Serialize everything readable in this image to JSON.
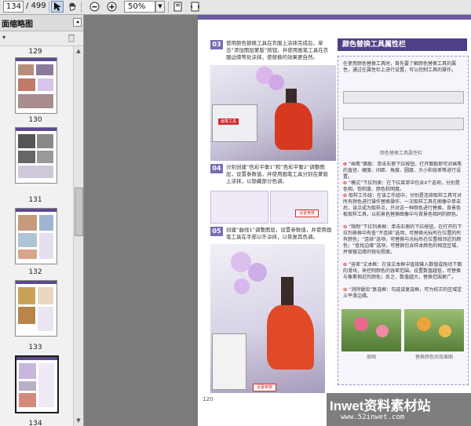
{
  "toolbar": {
    "current_page": "134",
    "total_pages": "/ 499",
    "zoom": "50%",
    "buttons": [
      "select-tool",
      "hand-tool",
      "zoom-out",
      "zoom-in",
      "fit-page",
      "fit-width"
    ]
  },
  "sidebar": {
    "title": "面缩略图",
    "options_glyph": "▾",
    "thumbnails": [
      {
        "label": "129"
      },
      {
        "label": "130"
      },
      {
        "label": "131"
      },
      {
        "label": "132"
      },
      {
        "label": "133"
      },
      {
        "label": "134",
        "selected": true
      }
    ]
  },
  "page": {
    "step3_num": "03",
    "step3_text": "使用颜色替换工具在衣服上涂抹完成后，单击“添加图层蒙版”按钮，并使用画笔工具在衣服边缘等处涂抹，使替换的效果更自然。",
    "step3_tag": "画笔工具",
    "step4_num": "04",
    "step4_text": "分别创建“色彩平衡1”和“色彩平衡2”调整图层，设置参数值，并使用画笔工具分别在蒙版上涂抹，以隐藏部分色调。",
    "step4_tag": "设置参数",
    "step5_num": "05",
    "step5_text": "创建“曲线1”调整图层，设置参数值，并使用画笔工具在手部以外涂抹，以恢复其色调。",
    "step5_tag": "设置参数",
    "side_heading": "颜色替换工具属性栏",
    "side_intro": "在使用颜色替换工具时，首先要了解颜色替换工具的属性，通过在属性栏上进行设置，可以控制工具的操作。",
    "toolbar_caption": "颜色替换工具属性栏",
    "items": [
      {
        "n": "❶",
        "text": "“画笔”面板：单击右侧下拉按钮，打开面板即可对画笔的直径、硬度、间距、角度、圆度、大小和容差等进行设置。"
      },
      {
        "n": "❷",
        "text": "“模式”下拉列表：在下拉菜单中包含4个选项，分别是色相、饱和度、颜色和明度。"
      },
      {
        "n": "❸",
        "text": "取样工作组：在该工作组中，分别是连续取样工具可对所有颜色进行操作替换操作、一次取样工具在图像中单击后，该点成为取样点，只对这一种颜色进行替换、背景色板取样工具，以前景色替换图像中与背景色相同的颜色。"
      },
      {
        "n": "❹",
        "text": "“限制”下拉列表框：单击右侧的下拉按钮，在打开的下拉列表框中有查“不连续”选项，可替换光标所在位置的所有颜色；“连续”选项，可替换与光标所在位置相邻近的颜色；“查找边缘”选项，可替换包含样本颜色的相连区域，并保留边缘的锐化程度。"
      },
      {
        "n": "❺",
        "text": "“容差”文本框：在该文本框中直接输入数值或拖动下面的滑块，来控制颜色的容差范围。设置数值越低，可替换与像素相近的颜色；反之，数值越大，替换范围更广。"
      },
      {
        "n": "❻",
        "text": "“消除锯齿”复选框：勾选该复选框，可为校正的区域定义平滑边缘。"
      }
    ],
    "cap_original": "原图",
    "cap_result": "替换颜色后效果图",
    "page_number": "120"
  },
  "watermark": {
    "main": "Inwet资料素材站",
    "sub": "www.52inwet.com"
  }
}
